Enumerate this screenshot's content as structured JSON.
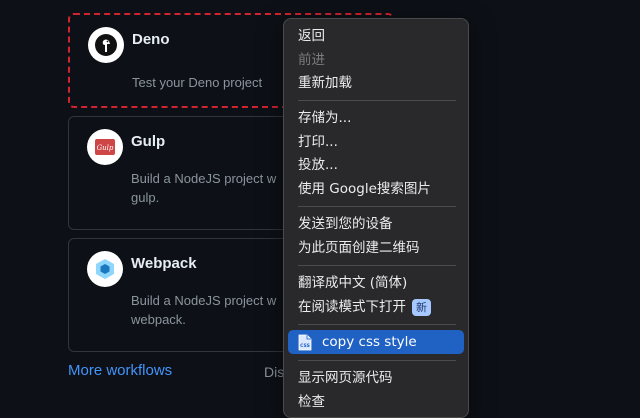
{
  "workflows": [
    {
      "name": "Deno",
      "description": "Test your Deno project",
      "logo_icon": "deno-dinosaur-icon"
    },
    {
      "name": "Gulp",
      "description": "Build a NodeJS project w\ngulp.",
      "logo_icon": "gulp-cup-icon"
    },
    {
      "name": "Webpack",
      "description": "Build a NodeJS project w\nwebpack.",
      "logo_icon": "webpack-cube-icon"
    }
  ],
  "more_workflows_label": "More workflows",
  "dis_text": "Dis",
  "context_menu": {
    "items": [
      {
        "label": "返回",
        "disabled": false
      },
      {
        "label": "前进",
        "disabled": true
      },
      {
        "label": "重新加载",
        "disabled": false
      },
      {
        "label": "存储为...",
        "disabled": false
      },
      {
        "label": "打印...",
        "disabled": false
      },
      {
        "label": "投放...",
        "disabled": false
      },
      {
        "label": "使用 Google搜索图片",
        "disabled": false
      },
      {
        "label": "发送到您的设备",
        "disabled": false
      },
      {
        "label": "为此页面创建二维码",
        "disabled": false
      },
      {
        "label": "翻译成中文 (简体)",
        "disabled": false
      },
      {
        "label": "在阅读模式下打开",
        "disabled": false,
        "badge": "新"
      },
      {
        "label": "copy css style",
        "highlighted": true,
        "icon": "css-document-icon"
      },
      {
        "label": "显示网页源代码",
        "disabled": false
      },
      {
        "label": "检查",
        "disabled": false
      }
    ]
  },
  "colors": {
    "background": "#0d1117",
    "link": "#4493f8",
    "menu_background": "#29292b",
    "menu_highlight": "#2062c4",
    "selected_card_border": "#d1242f",
    "badge": "#a6c8ff"
  }
}
